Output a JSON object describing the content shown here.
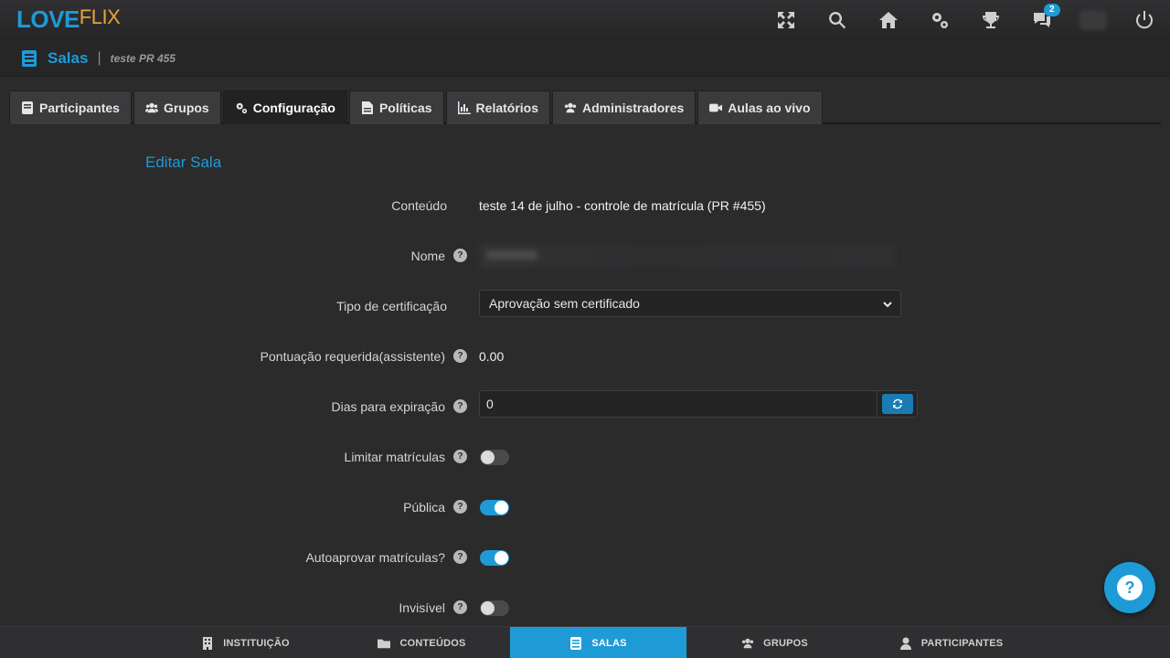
{
  "app": {
    "logo_love": "LOVE",
    "logo_flix": "FLIX",
    "notification_count": "2"
  },
  "header": {
    "title": "Salas",
    "subtitle": "teste PR 455"
  },
  "tabs": [
    {
      "label": "Participantes",
      "icon": "book-icon"
    },
    {
      "label": "Grupos",
      "icon": "users-icon"
    },
    {
      "label": "Configuração",
      "icon": "gears-icon",
      "active": true
    },
    {
      "label": "Políticas",
      "icon": "document-icon"
    },
    {
      "label": "Relatórios",
      "icon": "chart-icon"
    },
    {
      "label": "Administradores",
      "icon": "users-icon"
    },
    {
      "label": "Aulas ao vivo",
      "icon": "video-icon"
    }
  ],
  "form": {
    "section_title": "Editar Sala",
    "content_label": "Conteúdo",
    "content_value": "teste 14 de julho - controle de matrícula (PR #455)",
    "name_label": "Nome",
    "cert_label": "Tipo de certificação",
    "cert_value": "Aprovação sem certificado",
    "score_label": "Pontuação requerida(assistente)",
    "score_value": "0.00",
    "expiry_label": "Dias para expiração",
    "expiry_value": "0",
    "limit_label": "Limitar matrículas",
    "limit_on": false,
    "public_label": "Pública",
    "public_on": true,
    "autoapprove_label": "Autoaprovar matrículas?",
    "autoapprove_on": true,
    "invisible_label": "Invisível",
    "invisible_on": false,
    "help_glyph": "?"
  },
  "fab": {
    "glyph": "?"
  },
  "bottom_nav": [
    {
      "label": "INSTITUIÇÃO",
      "icon": "building-icon"
    },
    {
      "label": "CONTEÚDOS",
      "icon": "folder-icon"
    },
    {
      "label": "SALAS",
      "icon": "book-icon",
      "active": true
    },
    {
      "label": "GRUPOS",
      "icon": "users-icon"
    },
    {
      "label": "PARTICIPANTES",
      "icon": "user-icon"
    }
  ],
  "colors": {
    "accent": "#1e9bd7",
    "logo_flix": "#e8a23a",
    "background": "#2b2b2c"
  }
}
